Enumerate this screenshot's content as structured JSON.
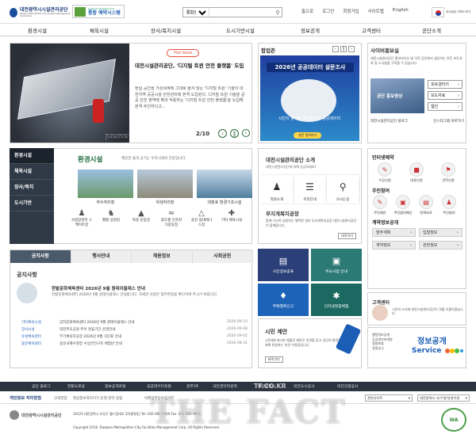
{
  "header": {
    "logo_title": "대전광역시시설관리공단",
    "logo_subtitle": "Daejeon Metropolitan City Facilities Management Corporation",
    "banner_small": "DAEJEON METROPOLITAN",
    "banner_title": "통합 예약시스템",
    "search_select": "통합검색",
    "search_placeholder": "",
    "utils": [
      "홈으로",
      "로그인",
      "회원가입",
      "사이트맵",
      "English"
    ],
    "emblem_text": "국가상징 가까이 보기"
  },
  "nav": [
    "환경시설",
    "체육시설",
    "장사/복지시설",
    "도시기반시설",
    "정보공개",
    "고객센터",
    "공단소개"
  ],
  "hero": {
    "badge": "Hot Issue",
    "title": "대전시설관리공단, '디지털 트윈 안전 플랫폼' 도입",
    "body": "현실 공간을 가상세계에 그대로 옮겨 담는 '디지털 트윈' 기술이 대전지역 공공시설 안전관리에 본격 도입된다. 디지털 트윈 기술을 공공 안전 영역에 확대 적용하는 '디지털 트윈 안전 플랫폼'을 도입해 본격 추진하다고...",
    "counter": "2/10",
    "image_caption": "Sim. Pre-configuration, 3, 4, 6 rolls, 6, 12, 30-5"
  },
  "popup": {
    "title": "팝업존",
    "year_title": "2026년 공공데이터 설문조사",
    "message": "시민의 참여로 풍성해지는 공공데이터",
    "go": "설문 참여하기"
  },
  "cyber": {
    "title": "사이버홍보실",
    "desc": "대전시설관리공단 홍보비디오 및 이전 공단에서 생산하는 모든 보도자료 및 소식들을 구독할 수 있습니다.",
    "video_label": "공단 홍보영상",
    "buttons": [
      "포토갤러리",
      "보도자료",
      "웹진"
    ],
    "sns": [
      "대전시설관리공단 블로그",
      "인스타그램 바로가기"
    ]
  },
  "env_sidebar": [
    "환경시설",
    "체육시설",
    "장사/복지",
    "도시기반"
  ],
  "env": {
    "title": "환경시설",
    "subtitle": "깨끗한 물과 공기는 우리시대의 건강입니다.",
    "facilities": [
      "하수처리장",
      "위생처리장",
      "대청호 환경기초시설"
    ],
    "icons": [
      {
        "icon": "person-icon",
        "label": "사업장관리 스케이트장"
      },
      {
        "icon": "walk-icon",
        "label": "월평 공원길"
      },
      {
        "icon": "field-icon",
        "label": "특봉 운동장"
      },
      {
        "icon": "swim-icon",
        "label": "봉도평 인조잔디운동장"
      },
      {
        "icon": "tent-icon",
        "label": "송강 실내테니스장"
      },
      {
        "icon": "more-icon",
        "label": "기타 체육시설"
      }
    ]
  },
  "notice": {
    "tabs": [
      "공지사항",
      "행사안내",
      "채용정보",
      "사회공헌"
    ],
    "title": "공지사항",
    "feature_title": "한밭문화체육센터 2026년 9월 원데이클래스 안내",
    "feature_body": "한밭문화체육센터 2026년 9월 원데이클래스 안내합니다. 자세한 사항은 첨부파일을 확인하여 주시기 바랍니다.",
    "items": [
      {
        "cat": "기타체육시설",
        "title": "갑자문화체육센터 2026년 9월 원데이클래스 안내",
        "date": "2026-09-10"
      },
      {
        "cat": "장사시설",
        "title": "대전추모공원 추석 연휴기간 운영안내",
        "date": "2026-09-08"
      },
      {
        "cat": "유성체육센터",
        "title": "무기체육지공장 2026년 9월 식단표 안내",
        "date": "2026-09-01"
      },
      {
        "cat": "용문체육센터",
        "title": "용문국제수영장 수상안전구조 체험반 안내",
        "date": "2026-08-31"
      }
    ]
  },
  "intro": {
    "title": "대전시설관리공단 소개",
    "subtitle": "대전시설관리공단에 대해 궁금하세요?",
    "items": [
      "직원소개",
      "조직안내",
      "오시는길"
    ],
    "noticeboard_title": "무지개복지공장",
    "noticeboard_text": "함께 나누며 성장하는 행복한 일터 무지개복지공장 대전시설관리공단이 함께합니다.",
    "more": "바로가기"
  },
  "tiles": [
    {
      "label": "사전정보공표",
      "color": "#2b3f78",
      "icon": "doc-icon"
    },
    {
      "label": "주요사업 안내",
      "color": "#2c7a76",
      "icon": "monitor-icon"
    },
    {
      "label": "부패행위신고",
      "color": "#1d63b8",
      "icon": "alarm-icon"
    },
    {
      "label": "인터넷청렴체험",
      "color": "#1b6960",
      "icon": "net-icon"
    }
  ],
  "proposal": {
    "title": "시민 제안",
    "text": "시민제안게시판 제출된 제안은 의견을 듣고 공단의 발전을 위해 반영하는 의견 수렴장입니다.",
    "more": "바로가기"
  },
  "right": {
    "interview_title": "인터넷예약",
    "interview_items": [
      "수강신청",
      "대관신청",
      "견학신청"
    ],
    "citizen_title": "주민참여",
    "citizen_items": [
      "주민제안",
      "주민참여예산",
      "정책자료",
      "주민참여"
    ],
    "contract_title": "계약정보공개",
    "contract_buttons": [
      "발주계획",
      "입찰정보",
      "계약정보",
      "관련정보"
    ]
  },
  "customer": {
    "title": "고객센터",
    "text": "시민의 소리에 대전시설관리공단이 귀를 기울이겠습니다.",
    "more": "바로가기"
  },
  "infoopen": {
    "items": [
      "행정정보공개",
      "공공데이터개방",
      "청렴포털",
      "경영공시"
    ],
    "big": "정보공개",
    "service": "Service"
  },
  "footer": {
    "nav": [
      "공단 블로그",
      "한밭도로공",
      "정보공개포털",
      "공공데이터포털",
      "정부24",
      "국민권익위원회",
      "대전광역시",
      "대전도시공사",
      "대전관광공사"
    ],
    "privacy": "개인정보 처리방침",
    "links": [
      "고객헌장",
      "영상정보처리기기 운영·관리 방침",
      "이메일무단수집거부",
      "사이트맵"
    ],
    "select1": "관련사이트",
    "select2": "대전광역시 시/구청/유관기관",
    "address": "34123 대전광역시 유성구 월드컵대로 32(봉명동) Tel. 042-000-0000 Fax. 042-000-0000",
    "copyright": "Copyright 2016. Daejeon Metropolitan City Facilities Management Corp. All Rights Reserved.",
    "logo": "대전광역시시설관리공단",
    "wa": "WA"
  },
  "watermark": {
    "small": "TF.CO.KR",
    "big": "THE FACT"
  }
}
